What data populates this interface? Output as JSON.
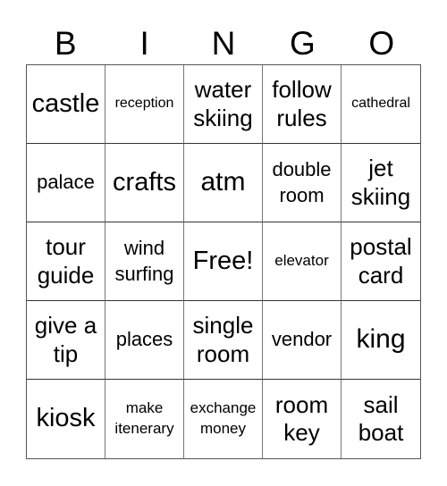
{
  "header": {
    "letters": [
      "B",
      "I",
      "N",
      "G",
      "O"
    ]
  },
  "cells": [
    "castle",
    "reception",
    "water skiing",
    "follow rules",
    "cathedral",
    "palace",
    "crafts",
    "atm",
    "double room",
    "jet skiing",
    "tour guide",
    "wind surfing",
    "Free!",
    "elevator",
    "postal card",
    "give a tip",
    "places",
    "single room",
    "vendor",
    "king",
    "kiosk",
    "make itenerary",
    "exchange money",
    "room key",
    "sail boat"
  ]
}
